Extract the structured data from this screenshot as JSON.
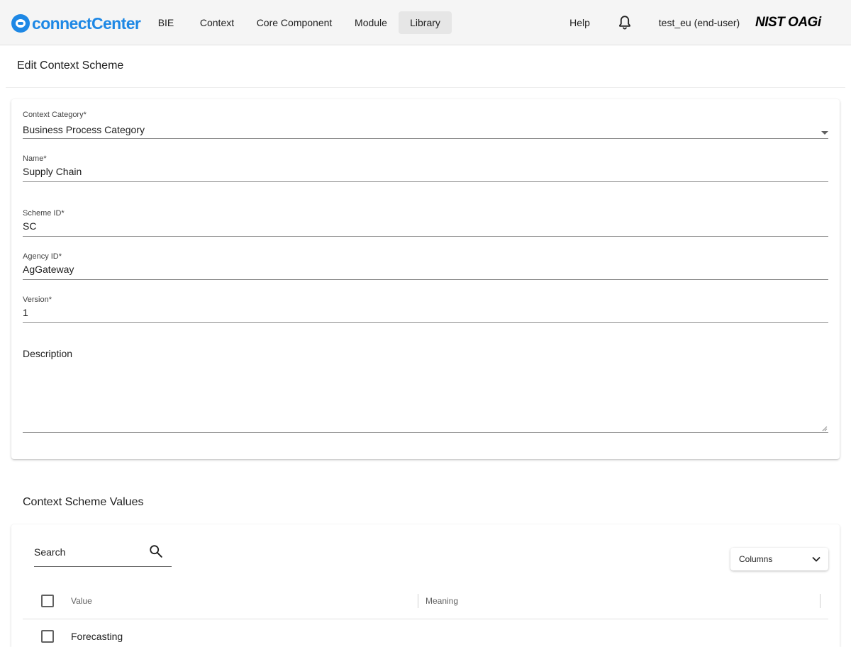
{
  "app": {
    "logo_text": "connectCenter",
    "brand_text": "NIST OAGi"
  },
  "nav": {
    "items": [
      {
        "label": "BIE"
      },
      {
        "label": "Context"
      },
      {
        "label": "Core Component"
      },
      {
        "label": "Module"
      },
      {
        "label": "Library"
      }
    ],
    "active": "Library",
    "help_label": "Help",
    "user_label": "test_eu (end-user)"
  },
  "page": {
    "title": "Edit Context Scheme"
  },
  "form": {
    "context_category": {
      "label": "Context Category*",
      "value": "Business Process Category"
    },
    "name": {
      "label": "Name*",
      "value": "Supply Chain"
    },
    "scheme_id": {
      "label": "Scheme ID*",
      "value": "SC"
    },
    "agency_id": {
      "label": "Agency ID*",
      "value": "AgGateway"
    },
    "version": {
      "label": "Version*",
      "value": "1"
    },
    "description": {
      "label": "Description",
      "value": ""
    }
  },
  "values_section": {
    "title": "Context Scheme Values",
    "search_label": "Search",
    "columns_label": "Columns",
    "table": {
      "headers": [
        "Value",
        "Meaning"
      ],
      "rows": [
        {
          "value": "Forecasting",
          "meaning": ""
        }
      ]
    }
  },
  "icons": {
    "search": "search-icon",
    "bell": "bell-icon",
    "dropdown": "dropdown-arrow-icon",
    "chevron": "chevron-down-icon"
  },
  "colors": {
    "brand_blue": "#1e88e5",
    "topbar_bg": "#f5f5f5",
    "active_nav_bg": "#e6e6e6"
  }
}
